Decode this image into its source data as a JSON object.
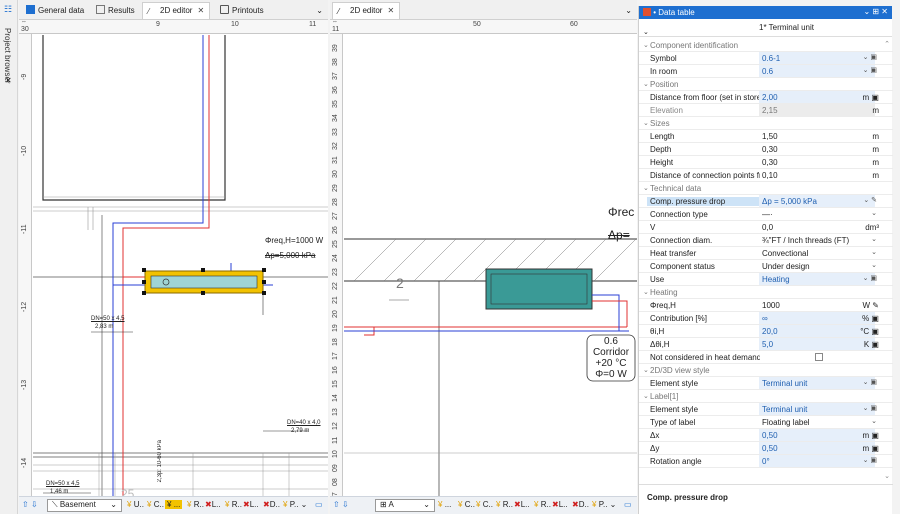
{
  "project_browser": {
    "label": "Project browser"
  },
  "left_tabs": [
    {
      "label": "General data"
    },
    {
      "label": "Results"
    },
    {
      "label": "2D editor"
    },
    {
      "label": "Printouts"
    }
  ],
  "right_tabs": [
    {
      "label": "2D editor"
    }
  ],
  "left_pane": {
    "ruler_h": [
      "9",
      "10",
      "11"
    ],
    "ruler_h_origin": "30",
    "ruler_v": [
      "-9",
      "-10",
      "-11",
      "-12",
      "-13",
      "-14"
    ],
    "annotations": {
      "phi_req": "Φreq,H=1000 W",
      "dp": "Δp=5,000 kPa",
      "dn1": "DN=50 x 4,5",
      "dn1_len": "2,83 m",
      "dn2": "DN=40 x 4,0",
      "dn2_len": "2,79 m",
      "dn3": "DN=50 x 4,5",
      "dn3_len": "1,46 m",
      "num25": "25",
      "vert_text": "2,3p: 10-60 kPa"
    }
  },
  "right_pane": {
    "ruler_v": [
      "39",
      "38",
      "37",
      "36",
      "35",
      "34",
      "33",
      "32",
      "31",
      "30",
      "29",
      "28",
      "27",
      "26",
      "25",
      "24",
      "23",
      "22",
      "21",
      "20",
      "19",
      "18",
      "17",
      "16",
      "15",
      "14",
      "13",
      "12",
      "11",
      "10",
      "09",
      "08",
      "07"
    ],
    "ruler_h": [
      "50",
      "60"
    ],
    "ruler_h_origin": "11",
    "annotations": {
      "phi_cut": "Φrec",
      "dp_cut": "Δp=",
      "num2": "2"
    },
    "room": {
      "num": "0.6",
      "name": "Corridor",
      "temp": "+20 °C",
      "phi": "Φ=0 W"
    }
  },
  "left_status": {
    "level": "Basement",
    "items": [
      "U..",
      "C..",
      "...",
      "R..",
      "L..",
      "R..",
      "L..",
      "D..",
      "P.."
    ]
  },
  "right_status": {
    "level": "A",
    "items": [
      "...",
      "C..",
      "C..",
      "R..",
      "L..",
      "R..",
      "L..",
      "D..",
      "P.."
    ]
  },
  "data_table": {
    "title": "Data table",
    "selector": "1* Terminal unit",
    "rows": [
      {
        "type": "group",
        "label": "Component identification"
      },
      {
        "label": "Symbol",
        "value": "0.6-1",
        "style": "blue",
        "ctl": "⌄ ▣"
      },
      {
        "label": "In room",
        "value": "0.6",
        "style": "blue",
        "ctl": "⌄ ▣"
      },
      {
        "type": "group",
        "label": "Position"
      },
      {
        "label": "Distance from floor (set in storey d",
        "value": "2,00",
        "style": "blue",
        "unit": "m ▣"
      },
      {
        "label": "Elevation",
        "value": "2,15",
        "style": "gray",
        "unit": "m",
        "gray": true
      },
      {
        "type": "group",
        "label": "Sizes"
      },
      {
        "label": "Length",
        "value": "1,50",
        "unit": "m"
      },
      {
        "label": "Depth",
        "value": "0,30",
        "unit": "m"
      },
      {
        "label": "Height",
        "value": "0,30",
        "unit": "m"
      },
      {
        "label": "Distance of connection points fror",
        "value": "0,10",
        "unit": "m"
      },
      {
        "type": "group",
        "label": "Technical data"
      },
      {
        "label": "Comp. pressure drop",
        "value": "Δp = 5,000 kPa",
        "style": "blue",
        "ctl": "⌄ ✎",
        "hl": true
      },
      {
        "label": "Connection type",
        "value": "—·",
        "ctl": "⌄"
      },
      {
        "label": "V",
        "value": "0,0",
        "unit": "dm³"
      },
      {
        "label": "Connection diam.",
        "value": "¾\"FT / Inch threads (FT)",
        "ctl": "⌄"
      },
      {
        "label": "Heat transfer",
        "value": "Convectional",
        "ctl": "⌄"
      },
      {
        "label": "Component status",
        "value": "Under design",
        "ctl": "⌄"
      },
      {
        "label": "Use",
        "value": "Heating",
        "style": "blue",
        "ctl": "⌄ ▣"
      },
      {
        "type": "group",
        "label": "Heating"
      },
      {
        "label": "Φreq,H",
        "value": "1000",
        "unit": "W ✎"
      },
      {
        "label": "Contribution [%]",
        "value": "∞",
        "style": "blue",
        "unit": "% ▣"
      },
      {
        "label": "θi,H",
        "value": "20,0",
        "style": "blue",
        "unit": "°C ▣"
      },
      {
        "label": "Δθi,H",
        "value": "5,0",
        "style": "blue",
        "unit": "K ▣"
      },
      {
        "label": "Not considered in heat demand cc",
        "value": "",
        "checkbox": true
      },
      {
        "type": "group",
        "label": "2D/3D view style"
      },
      {
        "label": "Element style",
        "value": "Terminal unit",
        "style": "blue",
        "ctl": "⌄ ▣"
      },
      {
        "type": "group",
        "label": "Label[1]"
      },
      {
        "label": "Element style",
        "value": "Terminal unit",
        "style": "blue",
        "ctl": "⌄ ▣"
      },
      {
        "label": "Type of label",
        "value": "Floating label",
        "ctl": "⌄"
      },
      {
        "label": "Δx",
        "value": "0,50",
        "style": "blue",
        "unit": "m ▣"
      },
      {
        "label": "Δy",
        "value": "0,50",
        "style": "blue",
        "unit": "m ▣"
      },
      {
        "label": "Rotation angle",
        "value": "0°",
        "style": "blue",
        "ctl": "⌄ ▣"
      }
    ],
    "description": "Comp. pressure drop"
  }
}
